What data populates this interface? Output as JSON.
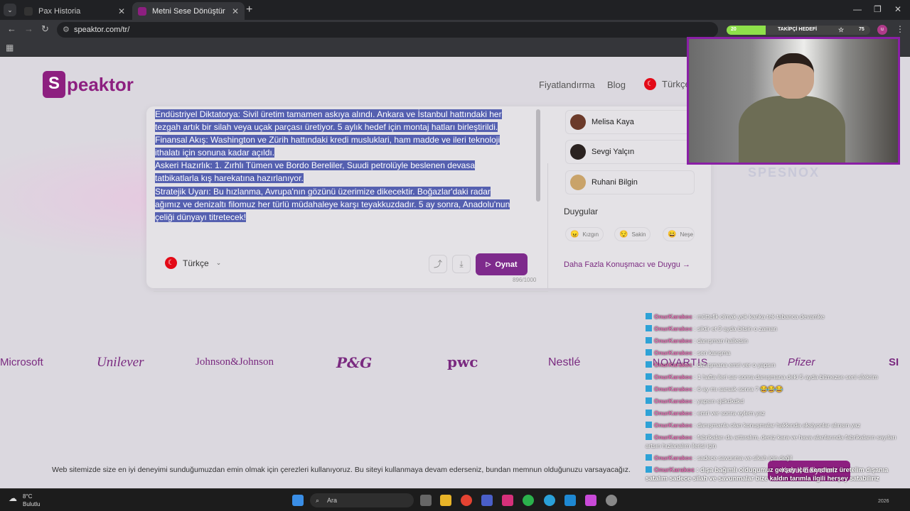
{
  "browser": {
    "tabs": [
      {
        "label": "Pax Historia",
        "color": "#333333"
      },
      {
        "label": "Metni Sese Dönüştür",
        "color": "#8d1f80"
      }
    ],
    "url": "speaktor.com/tr/",
    "follow_goal": {
      "current": "20",
      "label": "TAKİPÇİ HEDEFİ",
      "target": "75",
      "progress": 0.27
    },
    "profile_initial": "u"
  },
  "site": {
    "logo_mark": "S",
    "logo_text": "peaktor",
    "nav": {
      "pricing": "Fiyatlandırma",
      "blog": "Blog",
      "language": "Türkçe"
    },
    "editor_lines": [
      "Endüstriyel Diktatorya: Sivil üretim tamamen askıya alındı. Ankara ve İstanbul hattındaki her",
      "tezgah artık bir silah veya uçak parçası üretiyor. 5 aylık hedef için montaj hatları birleştirildi.",
      "Finansal Akış: Washington ve Zürih hattındaki kredi musluklari, ham madde ve ileri teknoloji",
      "ithalatı için sonuna kadar açıldı.",
      "Askeri Hazırlık: 1. Zırhlı Tümen ve Bordo Bereliler, Suudi petrolüyle beslenen devasa",
      "tatbikatlarla kış harekatına hazırlanıyor.",
      "Stratejik Uyarı: Bu hızlanma, Avrupa'nın gözünü üzerimize dikecektir. Boğazlar'daki radar",
      "ağımız ve denizaltı filomuz her türlü müdahaleye karşı teyakkuzdadır. 5 ay sonra, Anadolu'nun",
      "çeliği dünyayı titretecek!"
    ],
    "char_count": "896/1000",
    "language_select": "Türkçe",
    "play_label": "Oynat",
    "speakers": [
      {
        "name": "Melisa Kaya",
        "color": "#6b3a2a"
      },
      {
        "name": "Sevgi Yalçın",
        "color": "#2a2220"
      },
      {
        "name": "Ruhani Bilgin",
        "color": "#c9a36a"
      }
    ],
    "emotions_title": "Duygular",
    "emotions": [
      {
        "label": "Kızgın",
        "icon": "😠"
      },
      {
        "label": "Sakin",
        "icon": "😌"
      },
      {
        "label": "Neşe",
        "icon": "😄"
      }
    ],
    "more_link": "Daha Fazla Konuşmacı ve Duygu",
    "brands": [
      "Microsoft",
      "Unilever",
      "Johnson&Johnson",
      "P&G",
      "pwc",
      "Nestlé",
      "NOVARTIS",
      "Pfizer",
      "SI"
    ],
    "cookie_text": "Web sitemizde size en iyi deneyimi sunduğumuzdan emin olmak için çerezleri kullanıyoruz. Bu siteyi kullanmaya devam ederseniz, bundan memnun olduğunuzu varsayacağız.",
    "cookie_button": "Kabul Ediyorum"
  },
  "stream": {
    "streamer_tag": "SPESNOX",
    "chat": [
      {
        "user": "OnurKarakoc",
        "msg": "müttefik olmak yok kanka tek tabanca devamke"
      },
      {
        "user": "OnurKarakoc",
        "msg": "siktir et 9 ayda bitsin o zaman"
      },
      {
        "user": "OnurKarakoc",
        "msg": "danışman halletsin"
      },
      {
        "user": "OnurKarakoc",
        "msg": "sen karışma"
      },
      {
        "user": "OnurKarakoc",
        "msg": "danışmana emri ver o yapsın"
      },
      {
        "user": "OnurKarakoc",
        "msg": "1 hafta ileri sar sonra danışmana deki 5 ayda bitmezse seni sİekrim"
      },
      {
        "user": "OnurKarakoc",
        "msg": "6 ay mı sarsak sonra ? 😂😂😂"
      },
      {
        "user": "OnurKarakoc",
        "msg": "yapsın sjdkdkdkd"
      },
      {
        "user": "OnurKarakoc",
        "msg": "emri ver sonra eylem yaz"
      },
      {
        "user": "OnurKarakoc",
        "msg": "danışmanla olan konuşmalar hakkında aksiyonlar alınsın yaz"
      },
      {
        "user": "OnurKarakoc",
        "msg": "fabrikaları da arttıralım, deniz kara ve hava alanlarında fabrikaların sayıları artsın hızlanalım ilerisi için"
      },
      {
        "user": "OnurKarakoc",
        "msg": "sadece savunma ve sikah için değil"
      },
      {
        "user": "OnurKarakoc",
        "msg": "dışa bağımlı oldugumuz gerşey için kendimiz üretelim dışanıa satalım sadece silah ve savunmalar bize kaldın tarımla ilgili herşey satabiliriz"
      }
    ]
  },
  "taskbar": {
    "temperature": "8°C",
    "weather": "Bulutlu",
    "search_placeholder": "Ara",
    "year": "2026"
  }
}
